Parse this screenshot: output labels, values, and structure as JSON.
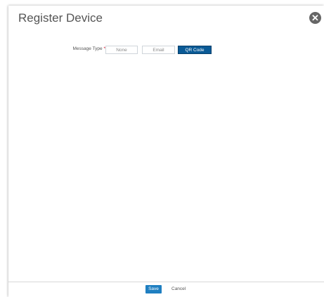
{
  "dialog": {
    "title": "Register Device",
    "close_icon": "close-circle-icon"
  },
  "form": {
    "message_type": {
      "label": "Message Type",
      "required_marker": "*",
      "options": [
        "None",
        "Email",
        "QR Code"
      ],
      "selected": "QR Code"
    }
  },
  "footer": {
    "save_label": "Save",
    "cancel_label": "Cancel"
  },
  "colors": {
    "accent": "#0a5a96",
    "save_button": "#1f7fc1",
    "required": "#d0021b",
    "close_icon": "#666666"
  }
}
